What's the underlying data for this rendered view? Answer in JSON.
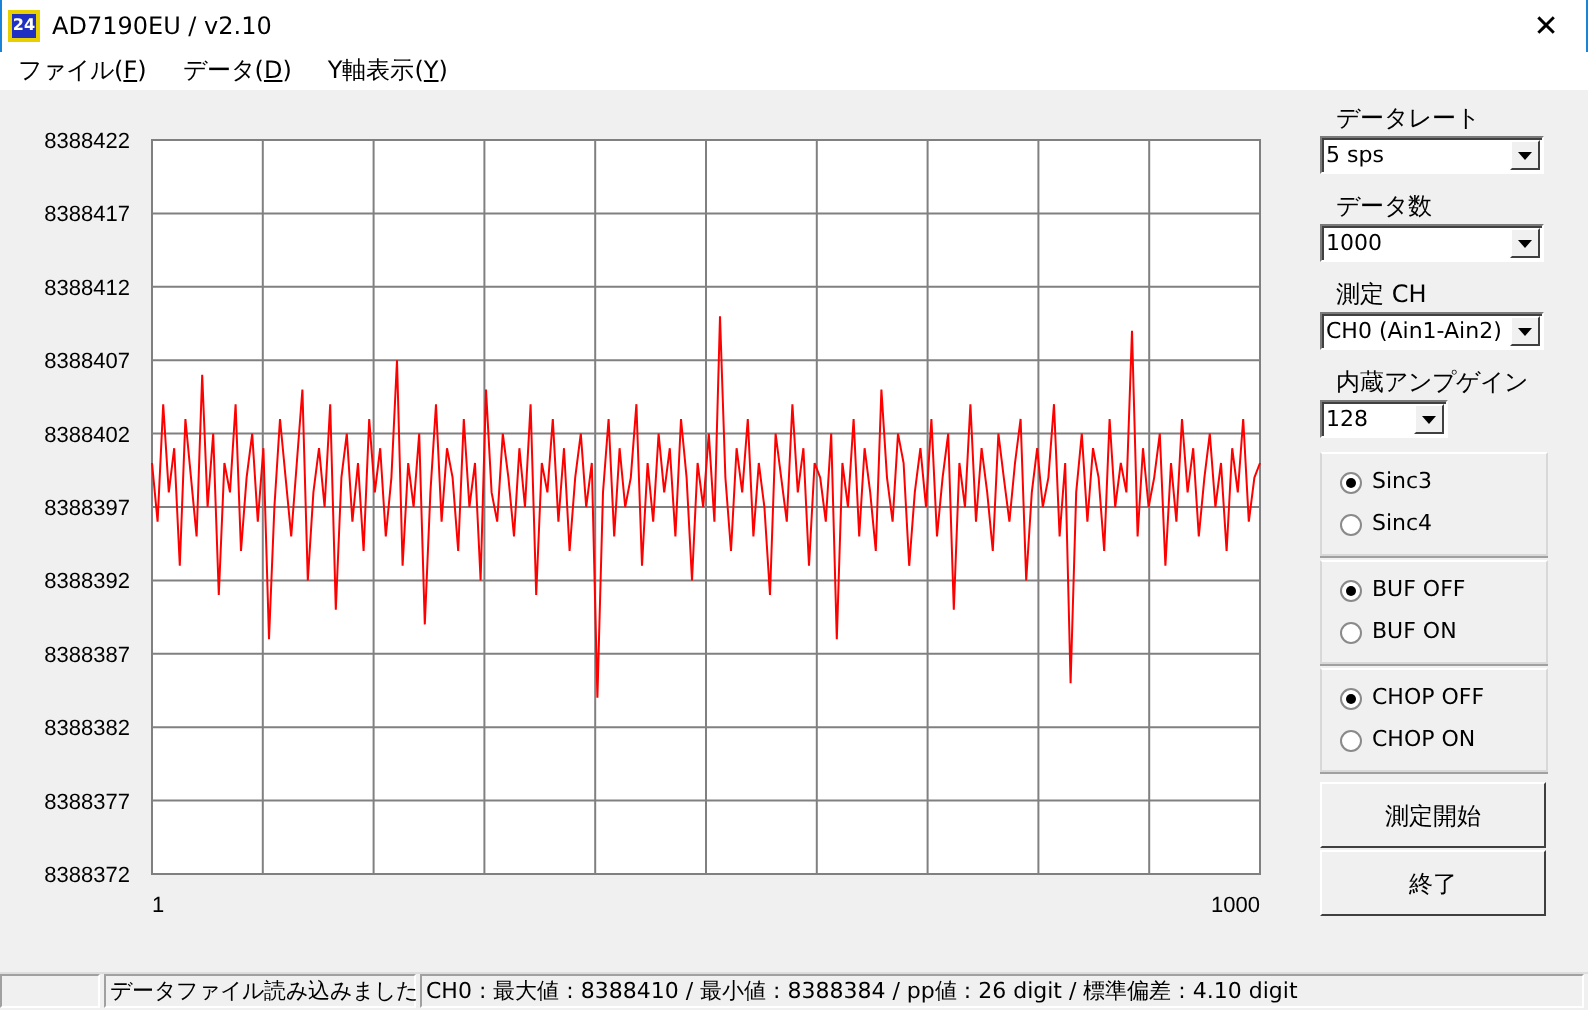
{
  "window": {
    "icon_label": "24",
    "title": "AD7190EU / v2.10",
    "close": "✕"
  },
  "menu": [
    {
      "label": "ファイル(",
      "key": "F",
      "end": ")"
    },
    {
      "label": "データ(",
      "key": "D",
      "end": ")"
    },
    {
      "label": "Y軸表示(",
      "key": "Y",
      "end": ")"
    }
  ],
  "chart": {
    "x_labels": [
      "1",
      "1000"
    ],
    "chart_data": {
      "type": "line",
      "grid": true,
      "ylim": [
        8388372,
        8388422
      ],
      "yticks": [
        8388372,
        8388377,
        8388382,
        8388387,
        8388392,
        8388397,
        8388402,
        8388407,
        8388412,
        8388417,
        8388422
      ],
      "series": [
        {
          "color": "#ff0000",
          "values": [
            8388400,
            8388396,
            8388404,
            8388398,
            8388401,
            8388393,
            8388403,
            8388399,
            8388395,
            8388406,
            8388397,
            8388402,
            8388391,
            8388400,
            8388398,
            8388404,
            8388394,
            8388399,
            8388402,
            8388396,
            8388401,
            8388388,
            8388397,
            8388403,
            8388399,
            8388395,
            8388400,
            8388405,
            8388392,
            8388398,
            8388401,
            8388397,
            8388404,
            8388390,
            8388399,
            8388402,
            8388396,
            8388400,
            8388394,
            8388403,
            8388398,
            8388401,
            8388395,
            8388399,
            8388407,
            8388393,
            8388400,
            8388397,
            8388402,
            8388389,
            8388398,
            8388404,
            8388396,
            8388401,
            8388399,
            8388394,
            8388403,
            8388397,
            8388400,
            8388392,
            8388405,
            8388398,
            8388396,
            8388402,
            8388399,
            8388395,
            8388401,
            8388397,
            8388404,
            8388391,
            8388400,
            8388398,
            8388403,
            8388396,
            8388401,
            8388394,
            8388399,
            8388402,
            8388397,
            8388400,
            8388384,
            8388398,
            8388403,
            8388395,
            8388401,
            8388397,
            8388399,
            8388404,
            8388393,
            8388400,
            8388396,
            8388402,
            8388398,
            8388401,
            8388395,
            8388403,
            8388399,
            8388392,
            8388400,
            8388397,
            8388402,
            8388396,
            8388410,
            8388399,
            8388394,
            8388401,
            8388398,
            8388403,
            8388395,
            8388400,
            8388397,
            8388391,
            8388402,
            8388399,
            8388396,
            8388404,
            8388398,
            8388401,
            8388393,
            8388400,
            8388399,
            8388396,
            8388402,
            8388388,
            8388400,
            8388397,
            8388403,
            8388395,
            8388401,
            8388398,
            8388394,
            8388405,
            8388399,
            8388396,
            8388402,
            8388400,
            8388393,
            8388398,
            8388401,
            8388397,
            8388403,
            8388395,
            8388399,
            8388402,
            8388390,
            8388400,
            8388397,
            8388404,
            8388396,
            8388401,
            8388398,
            8388394,
            8388402,
            8388399,
            8388396,
            8388400,
            8388403,
            8388392,
            8388398,
            8388401,
            8388397,
            8388399,
            8388404,
            8388395,
            8388400,
            8388385,
            8388398,
            8388402,
            8388396,
            8388401,
            8388399,
            8388394,
            8388403,
            8388397,
            8388400,
            8388398,
            8388409,
            8388395,
            8388401,
            8388397,
            8388399,
            8388402,
            8388393,
            8388400,
            8388396,
            8388403,
            8388398,
            8388401,
            8388395,
            8388399,
            8388402,
            8388397,
            8388400,
            8388394,
            8388401,
            8388398,
            8388403,
            8388396,
            8388399,
            8388400
          ]
        }
      ]
    }
  },
  "settings": [
    {
      "label": "データレート",
      "value": "5 sps",
      "kind": "wide"
    },
    {
      "label": "データ数",
      "value": "1000",
      "kind": "wide"
    },
    {
      "label": "測定 CH",
      "value": "CH0 (Ain1-Ain2)",
      "kind": "wide"
    },
    {
      "label": "内蔵アンプゲイン",
      "value": "128",
      "kind": "narrow"
    }
  ],
  "radio_groups": [
    [
      {
        "label": "Sinc3",
        "selected": true
      },
      {
        "label": "Sinc4",
        "selected": false
      }
    ],
    [
      {
        "label": "BUF OFF",
        "selected": true
      },
      {
        "label": "BUF ON",
        "selected": false
      }
    ],
    [
      {
        "label": "CHOP OFF",
        "selected": true
      },
      {
        "label": "CHOP ON",
        "selected": false
      }
    ]
  ],
  "buttons": [
    "測定開始",
    "終了"
  ],
  "status_bar": {
    "message": "データファイル読み込みました",
    "stats": "CH0 : 最大値 : 8388410 / 最小値 : 8388384 / pp値 : 26 digit / 標準偏差 : 4.10 digit"
  }
}
